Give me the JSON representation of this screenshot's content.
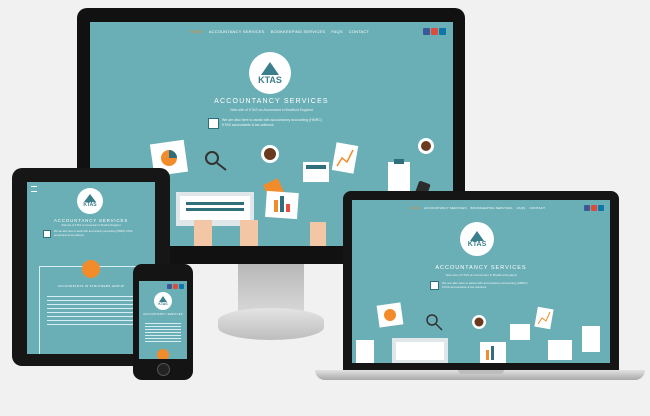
{
  "site": {
    "nav": [
      "HOME",
      "ACCOUNTANCY SERVICES",
      "BOOKKEEPING SERVICES",
      "FAQS",
      "CONTACT"
    ],
    "logo_text": "KTAS",
    "title": "ACCOUNTANCY SERVICES",
    "subtitle": "Web-site of KTAS an Accountant in Bradford England",
    "info": "We are also here to assist with accountancy accounting (HMRC) KTAS accountants & tax advisors",
    "card_title": "ACCOUNTANTS IN STRUTHERS GROUP"
  },
  "colors": {
    "teal": "#6aaeb6",
    "orange": "#f28c2a",
    "facebook": "#3b5998",
    "google": "#dd4b39",
    "linkedin": "#0e76a8"
  },
  "icons": [
    "facebook-icon",
    "google-plus-icon",
    "linkedin-icon",
    "document-icon",
    "pie-chart-icon",
    "magnifier-icon",
    "coffee-cup-icon",
    "calculator-icon",
    "laptop-icon",
    "clipboard-icon",
    "phone-icon",
    "chart-icon"
  ]
}
